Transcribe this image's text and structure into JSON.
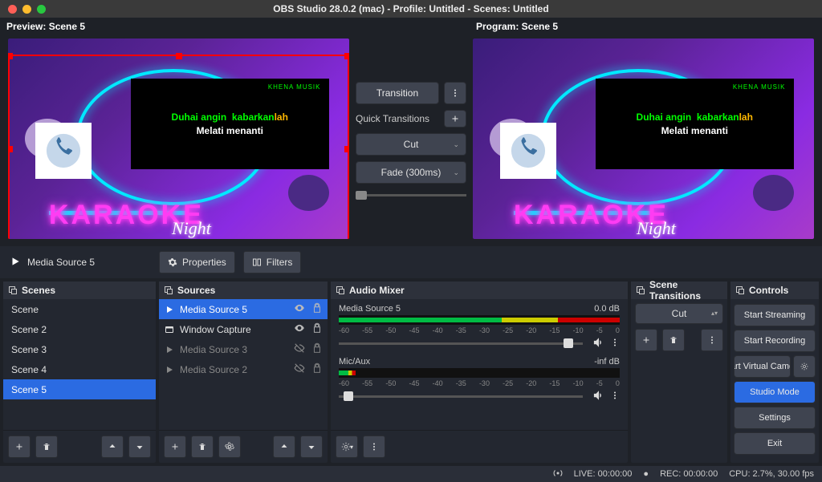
{
  "title": "OBS Studio 28.0.2 (mac) - Profile: Untitled - Scenes: Untitled",
  "preview_label": "Preview: Scene 5",
  "program_label": "Program: Scene 5",
  "karaoke": {
    "brand": "KHENA MUSIK",
    "lyric1a": "Duhai angin",
    "lyric1b": "kabarkan",
    "lyric1c": "lah",
    "lyric2": "Melati menanti",
    "neon": "KARAOKE",
    "neon_sub": "Night"
  },
  "center": {
    "transition": "Transition",
    "quick_label": "Quick Transitions",
    "cut": "Cut",
    "fade": "Fade (300ms)"
  },
  "media_bar": {
    "source": "Media Source 5",
    "properties": "Properties",
    "filters": "Filters"
  },
  "panels": {
    "scenes": "Scenes",
    "sources": "Sources",
    "mixer": "Audio Mixer",
    "transitions": "Scene Transitions",
    "controls": "Controls"
  },
  "scenes": [
    "Scene",
    "Scene 2",
    "Scene 3",
    "Scene 4",
    "Scene 5"
  ],
  "scene_selected": 4,
  "sources": [
    {
      "label": "Media Source 5",
      "icon": "play",
      "vis": true,
      "locked": false,
      "selected": true,
      "dim": false
    },
    {
      "label": "Window Capture",
      "icon": "window",
      "vis": true,
      "locked": false,
      "selected": false,
      "dim": false
    },
    {
      "label": "Media Source 3",
      "icon": "play",
      "vis": false,
      "locked": false,
      "selected": false,
      "dim": true
    },
    {
      "label": "Media Source 2",
      "icon": "play",
      "vis": false,
      "locked": false,
      "selected": false,
      "dim": true
    }
  ],
  "mixer": {
    "tracks": [
      {
        "name": "Media Source 5",
        "db": "0.0 dB",
        "fill": "full",
        "thumb": 92
      },
      {
        "name": "Mic/Aux",
        "db": "-inf dB",
        "fill": "short",
        "thumb": 2
      }
    ],
    "ticks": [
      "-60",
      "-55",
      "-50",
      "-45",
      "-40",
      "-35",
      "-30",
      "-25",
      "-20",
      "-15",
      "-10",
      "-5",
      "0"
    ]
  },
  "transitions": {
    "current": "Cut"
  },
  "controls": {
    "start_streaming": "Start Streaming",
    "start_recording": "Start Recording",
    "virtual_cam": "art Virtual Came",
    "studio_mode": "Studio Mode",
    "settings": "Settings",
    "exit": "Exit"
  },
  "status": {
    "live": "LIVE: 00:00:00",
    "rec": "REC: 00:00:00",
    "cpu": "CPU: 2.7%, 30.00 fps"
  }
}
